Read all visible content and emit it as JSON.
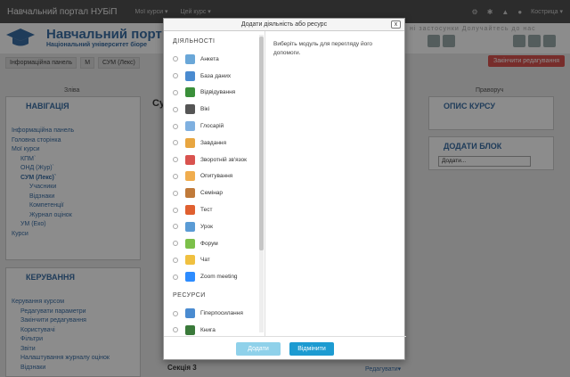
{
  "topnav": {
    "brand": "Навчальний портал НУБіП",
    "my_courses": "Мої курси ▾",
    "this_course": "Цей курс ▾",
    "user": "Кострица ▾"
  },
  "header": {
    "title": "Навчальний порт",
    "subtitle": "Національний університет біоре",
    "right_text": "ні застосунки Долучайтесь до нас"
  },
  "breadcrumb": [
    "Інформаційна панель",
    "М",
    "СУМ (Лекс)"
  ],
  "edit_off_button": "Закінчити редагування",
  "regions": {
    "left": "Зліва",
    "right": "Праворуч"
  },
  "nav_block": {
    "title": "НАВІГАЦІЯ",
    "items": [
      "Інформаційна панель",
      "Головна сторінка",
      "Мої курси",
      "КПМ`",
      "ОНД (Жур)`",
      "СУМ (Лекс)`",
      "Учасники",
      "Відзнаки",
      "Компетенції",
      "Журнал оцінок",
      "УМ (Еко)",
      "Курси"
    ]
  },
  "admin_block": {
    "title": "КЕРУВАННЯ",
    "items": [
      "Керування курсом",
      "Редагувати параметри",
      "Закінчити редагування",
      "Користувачі",
      "Фільтри",
      "Звіти",
      "Налаштування журналу оцінок",
      "Відзнаки"
    ]
  },
  "summary_block": {
    "title": "ОПИС КУРСУ"
  },
  "addblock_block": {
    "title": "ДОДАТИ БЛОК",
    "select": "Додати..."
  },
  "course_title_fragment": "Су",
  "section3": {
    "label": "Секція 3",
    "edit": "Редагувати▾"
  },
  "modal": {
    "title": "Додати діяльність або ресурс",
    "close": "x",
    "section_activities": "ДІЯЛЬНОСТІ",
    "activities": [
      {
        "label": "Анкета",
        "icon": "survey-icon",
        "color": "#6aa7d8"
      },
      {
        "label": "База даних",
        "icon": "database-icon",
        "color": "#4a8bd0"
      },
      {
        "label": "Відвідування",
        "icon": "attendance-icon",
        "color": "#3a8f3a"
      },
      {
        "label": "Вікі",
        "icon": "wiki-icon",
        "color": "#555555"
      },
      {
        "label": "Глосарій",
        "icon": "glossary-icon",
        "color": "#7fb0e0"
      },
      {
        "label": "Завдання",
        "icon": "assignment-icon",
        "color": "#e8a640"
      },
      {
        "label": "Зворотній зв'язок",
        "icon": "feedback-icon",
        "color": "#d9534f"
      },
      {
        "label": "Опитування",
        "icon": "choice-icon",
        "color": "#f0ad4e"
      },
      {
        "label": "Семінар",
        "icon": "workshop-icon",
        "color": "#c07a3a"
      },
      {
        "label": "Тест",
        "icon": "quiz-icon",
        "color": "#e06030"
      },
      {
        "label": "Урок",
        "icon": "lesson-icon",
        "color": "#5a9bd5"
      },
      {
        "label": "Форум",
        "icon": "forum-icon",
        "color": "#7cc04a"
      },
      {
        "label": "Чат",
        "icon": "chat-icon",
        "color": "#f0c040"
      },
      {
        "label": "Zoom meeting",
        "icon": "zoom-icon",
        "color": "#2d8cff"
      }
    ],
    "section_resources": "РЕСУРСИ",
    "resources": [
      {
        "label": "Гіперпосилання",
        "icon": "url-icon",
        "color": "#4a8bd0"
      },
      {
        "label": "Книга",
        "icon": "book-icon",
        "color": "#3a7a3a"
      }
    ],
    "help_text": "Виберіть модуль для перегляду його допомоги.",
    "add_button": "Додати",
    "cancel_button": "Відмінити"
  }
}
